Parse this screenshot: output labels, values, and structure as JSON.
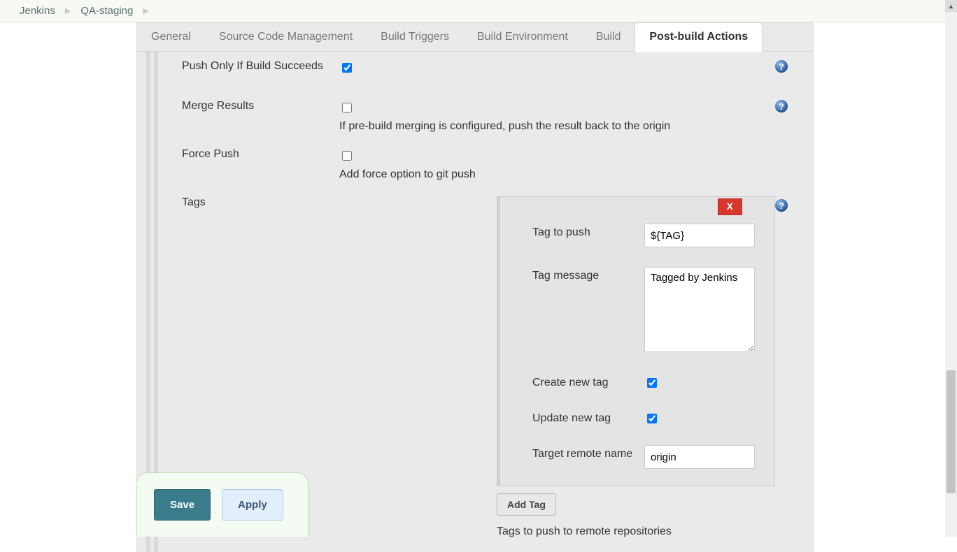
{
  "breadcrumb": {
    "root": "Jenkins",
    "job": "QA-staging"
  },
  "tabs": {
    "general": "General",
    "scm": "Source Code Management",
    "triggers": "Build Triggers",
    "env": "Build Environment",
    "build": "Build",
    "post": "Post-build Actions"
  },
  "push": {
    "only_succeed_label": "Push Only If Build Succeeds",
    "only_succeed_checked": true,
    "merge_label": "Merge Results",
    "merge_checked": false,
    "merge_desc": "If pre-build merging is configured, push the result back to the origin",
    "force_label": "Force Push",
    "force_checked": false,
    "force_desc": "Add force option to git push",
    "tags_label": "Tags"
  },
  "tag": {
    "close_label": "X",
    "to_push_label": "Tag to push",
    "to_push_value": "${TAG}",
    "message_label": "Tag message",
    "message_value": "Tagged by Jenkins",
    "create_label": "Create new tag",
    "create_checked": true,
    "update_label": "Update new tag",
    "update_checked": true,
    "remote_label": "Target remote name",
    "remote_value": "origin",
    "add_btn": "Add Tag",
    "desc": "Tags to push to remote repositories"
  },
  "buttons": {
    "save": "Save",
    "apply": "Apply"
  }
}
